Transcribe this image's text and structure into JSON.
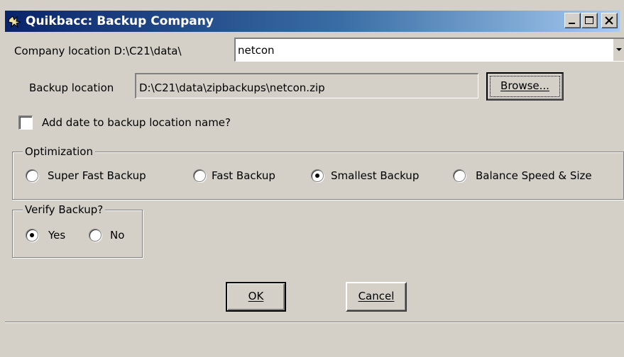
{
  "window": {
    "title": "Quikbacc: Backup Company",
    "icon": "quikbacc-app-icon",
    "controls": {
      "minimize": "minimize-icon",
      "maximize": "maximize-icon",
      "close": "close-icon"
    }
  },
  "company": {
    "label": "Company location D:\\C21\\data\\",
    "value": "netcon"
  },
  "backup": {
    "label": "Backup location",
    "value": "D:\\C21\\data\\zipbackups\\netcon.zip",
    "browse_label": "Browse..."
  },
  "add_date": {
    "label": "Add date to backup location name?",
    "checked": false
  },
  "optimization": {
    "legend": "Optimization",
    "options": [
      {
        "label": "Super Fast Backup",
        "selected": false
      },
      {
        "label": "Fast Backup",
        "selected": false
      },
      {
        "label": "Smallest Backup",
        "selected": true
      },
      {
        "label": "Balance Speed & Size",
        "selected": false
      }
    ]
  },
  "verify": {
    "legend": "Verify Backup?",
    "options": [
      {
        "label": "Yes",
        "selected": true
      },
      {
        "label": "No",
        "selected": false
      }
    ]
  },
  "actions": {
    "ok_label": "OK",
    "cancel_label": "Cancel"
  },
  "colors": {
    "face": "#d4d0c8",
    "title_start": "#0a246a",
    "title_end": "#a6caf0"
  }
}
